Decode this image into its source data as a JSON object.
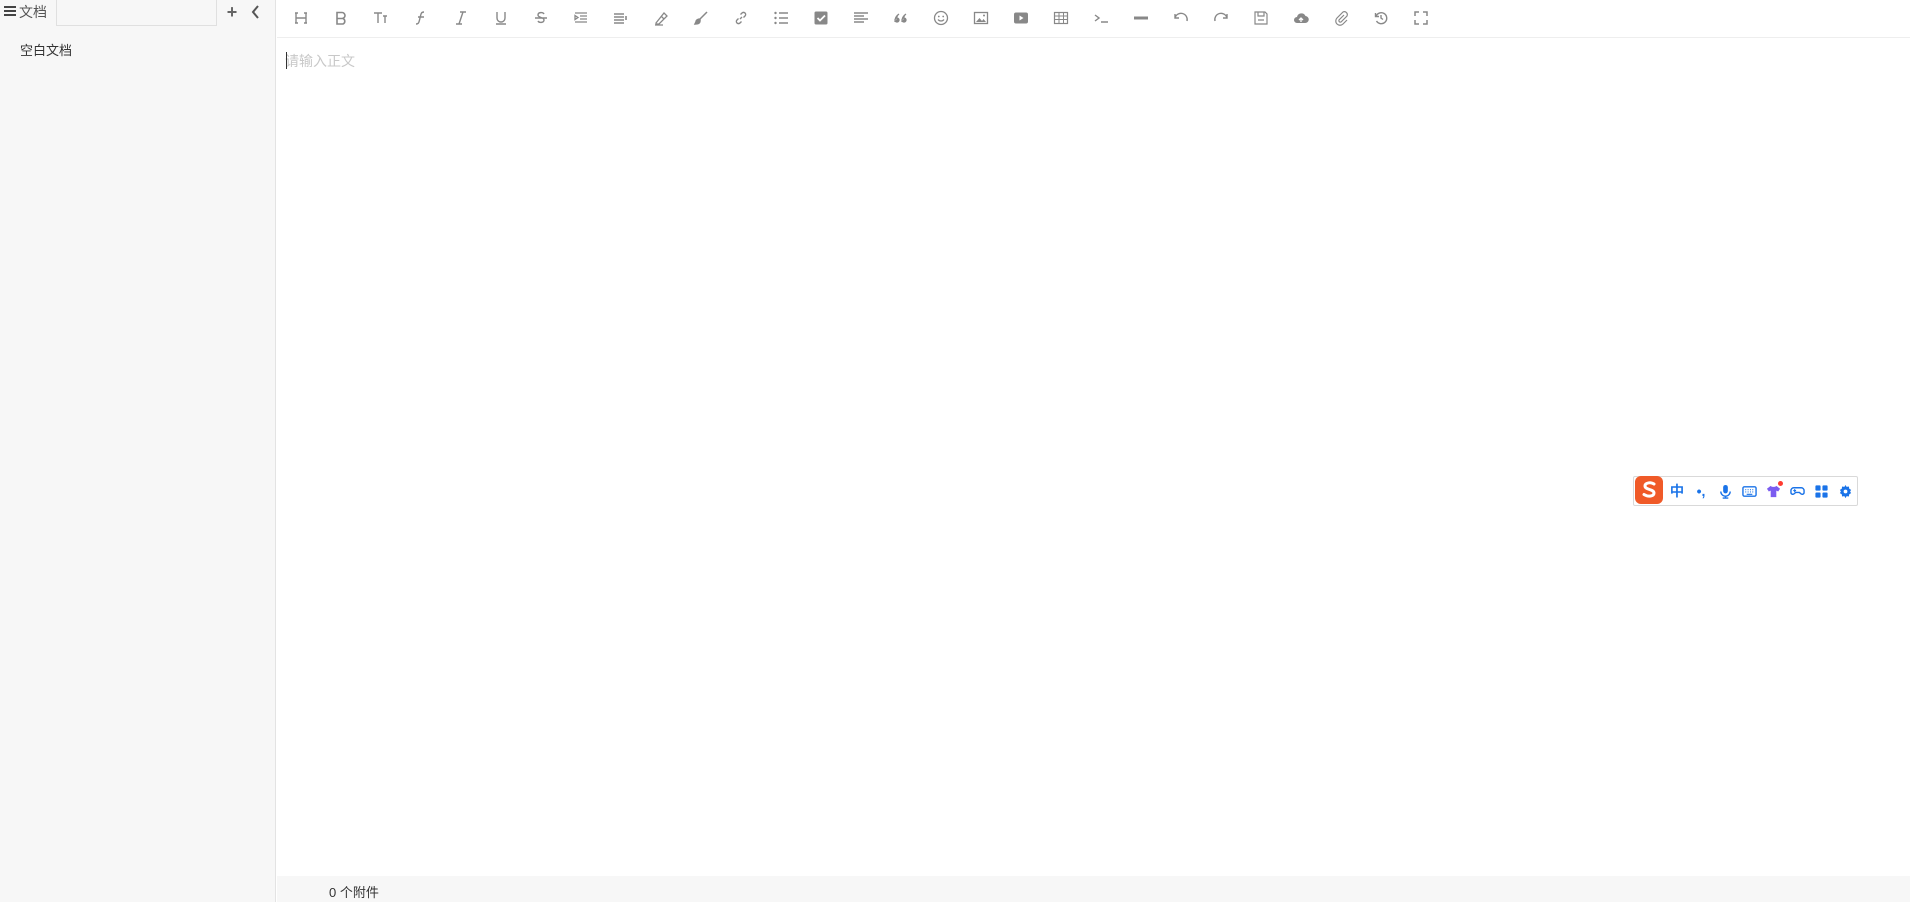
{
  "sidebar": {
    "title": "文档",
    "search_placeholder": "",
    "documents": [
      {
        "label": "空白文档"
      }
    ]
  },
  "toolbar": {
    "buttons": [
      "heading",
      "bold",
      "font-size",
      "font-family",
      "italic",
      "underline",
      "strikethrough",
      "indent",
      "line-height",
      "eraser",
      "brush",
      "link",
      "list",
      "checkbox",
      "align",
      "quote",
      "emoji",
      "image",
      "video",
      "table",
      "code",
      "divider",
      "undo",
      "redo",
      "save",
      "cloud-upload",
      "attachment",
      "history",
      "fullscreen"
    ]
  },
  "editor": {
    "placeholder": "请输入正文"
  },
  "footer": {
    "attachments": "0 个附件"
  },
  "ime": {
    "mode": "中",
    "punct": "•,",
    "accent": "#1a73e8",
    "logo_color": "#f05a28"
  }
}
